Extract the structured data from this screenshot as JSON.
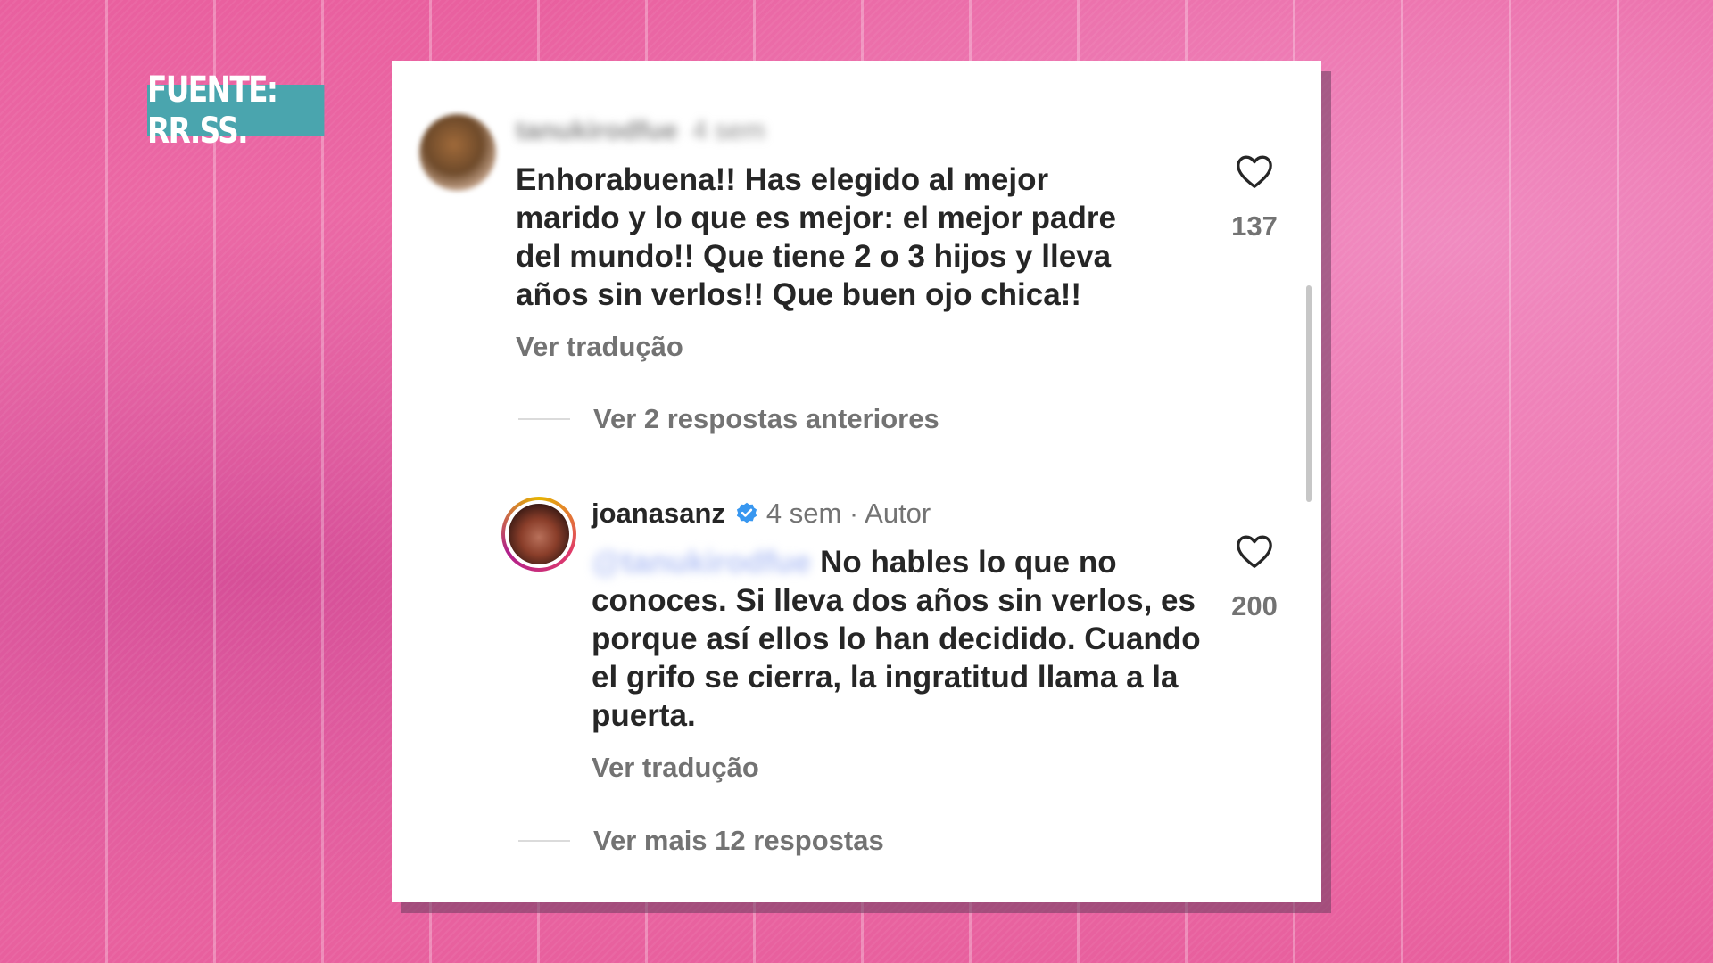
{
  "source_badge": "FUENTE: RR.SS.",
  "comment": {
    "username": "tanukirodfue",
    "time": "4 sem",
    "text": "Enhorabuena!! Has elegido al mejor marido y lo que es mejor: el mejor padre del mundo!! Que tiene 2 o 3 hijos y lleva años sin verlos!! Que buen ojo chica!!",
    "see_translation": "Ver tradução",
    "likes": "137",
    "view_previous_replies": "Ver 2 respostas anteriores"
  },
  "reply": {
    "username": "joanasanz",
    "meta": "4 sem · Autor",
    "mention": "@tanukirodfue",
    "text": "No hables lo que no conoces. Si lleva dos años sin verlos, es porque así ellos lo han decidido. Cuando el grifo se cierra, la ingratitud llama a la puerta.",
    "see_translation": "Ver tradução",
    "likes": "200",
    "view_more_replies": "Ver mais 12 respostas"
  },
  "colors": {
    "verified_badge": "#3897f0",
    "badge_background": "#4aa5ae"
  },
  "icons": [
    "heart-icon",
    "verified-icon"
  ]
}
